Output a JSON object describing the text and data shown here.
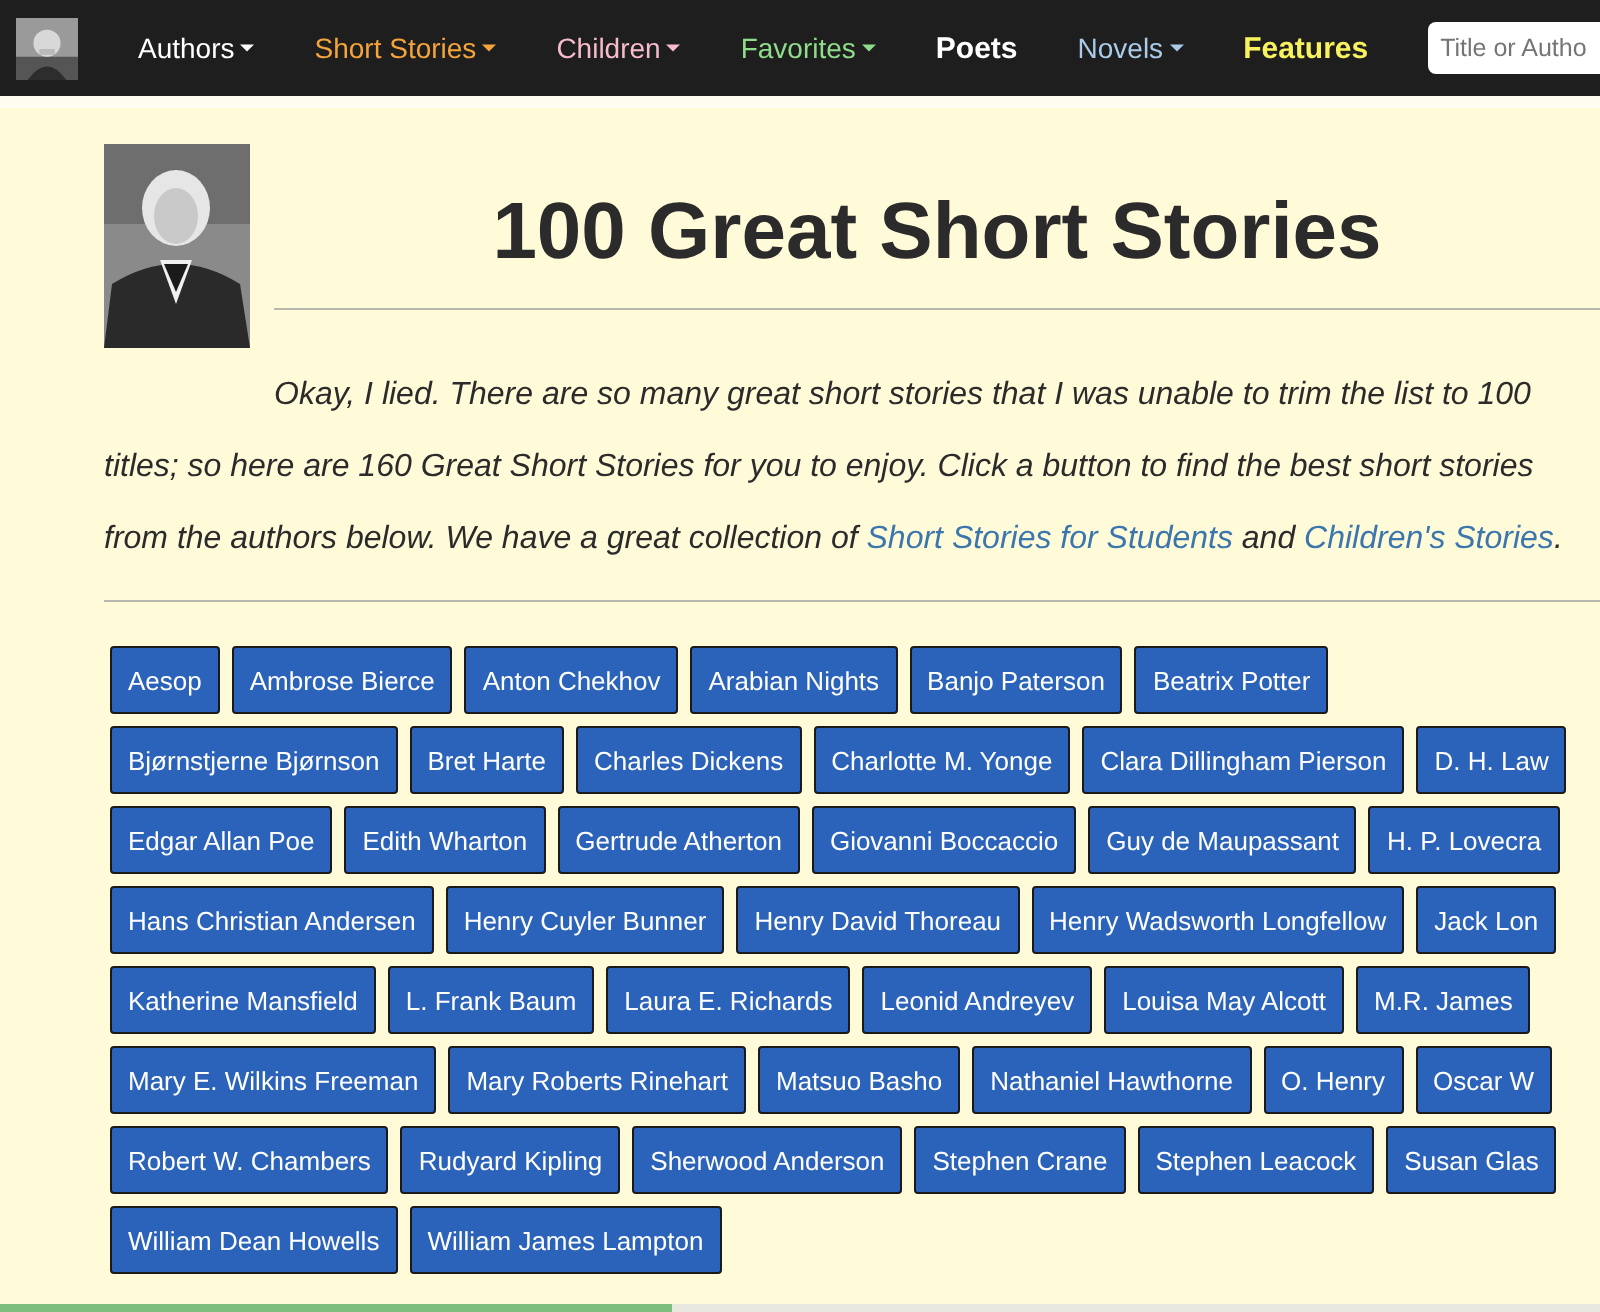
{
  "nav": {
    "items": [
      {
        "label": "Authors",
        "color": "#ffffff",
        "dropdown": true
      },
      {
        "label": "Short Stories",
        "color": "#f4a43a",
        "dropdown": true
      },
      {
        "label": "Children",
        "color": "#f6bccb",
        "dropdown": true
      },
      {
        "label": "Favorites",
        "color": "#8edb8a",
        "dropdown": true
      },
      {
        "label": "Poets",
        "color": "#ffffff",
        "dropdown": false
      },
      {
        "label": "Novels",
        "color": "#a9cbe8",
        "dropdown": true
      },
      {
        "label": "Features",
        "color": "#f7f25e",
        "dropdown": false
      }
    ],
    "search": {
      "placeholder": "Title or Autho"
    }
  },
  "title": "100 Great Short Stories",
  "intro": "Okay, I lied. There are so many great short stories that I was unable to trim the list to 100 titles; so here are 160 Great Short Stories for you to enjoy. Click a button to find the best short stories from the authors below. We have a great collection of ",
  "links": [
    "Short Stories for Students",
    "Children's Stories"
  ],
  "link_joiner": " and ",
  "end": ".",
  "author_rows": [
    [
      "Aesop",
      "Ambrose Bierce",
      "Anton Chekhov",
      "Arabian Nights",
      "Banjo Paterson",
      "Beatrix Potter"
    ],
    [
      "Bjørnstjerne Bjørnson",
      "Bret Harte",
      "Charles Dickens",
      "Charlotte M. Yonge",
      "Clara Dillingham Pierson",
      "D. H. Law"
    ],
    [
      "Edgar Allan Poe",
      "Edith Wharton",
      "Gertrude Atherton",
      "Giovanni Boccaccio",
      "Guy de Maupassant",
      "H. P. Lovecra"
    ],
    [
      "Hans Christian Andersen",
      "Henry Cuyler Bunner",
      "Henry David Thoreau",
      "Henry Wadsworth Longfellow",
      "Jack Lon"
    ],
    [
      "Katherine Mansfield",
      "L. Frank Baum",
      "Laura E. Richards",
      "Leonid Andreyev",
      "Louisa May Alcott",
      "M.R. James"
    ],
    [
      "Mary E. Wilkins Freeman",
      "Mary Roberts Rinehart",
      "Matsuo Basho",
      "Nathaniel Hawthorne",
      "O. Henry",
      "Oscar W"
    ],
    [
      "Robert W. Chambers",
      "Rudyard Kipling",
      "Sherwood Anderson",
      "Stephen Crane",
      "Stephen Leacock",
      "Susan Glas"
    ],
    [
      "William Dean Howells",
      "William James Lampton"
    ]
  ],
  "reading_progress": {
    "level": 0.42
  }
}
